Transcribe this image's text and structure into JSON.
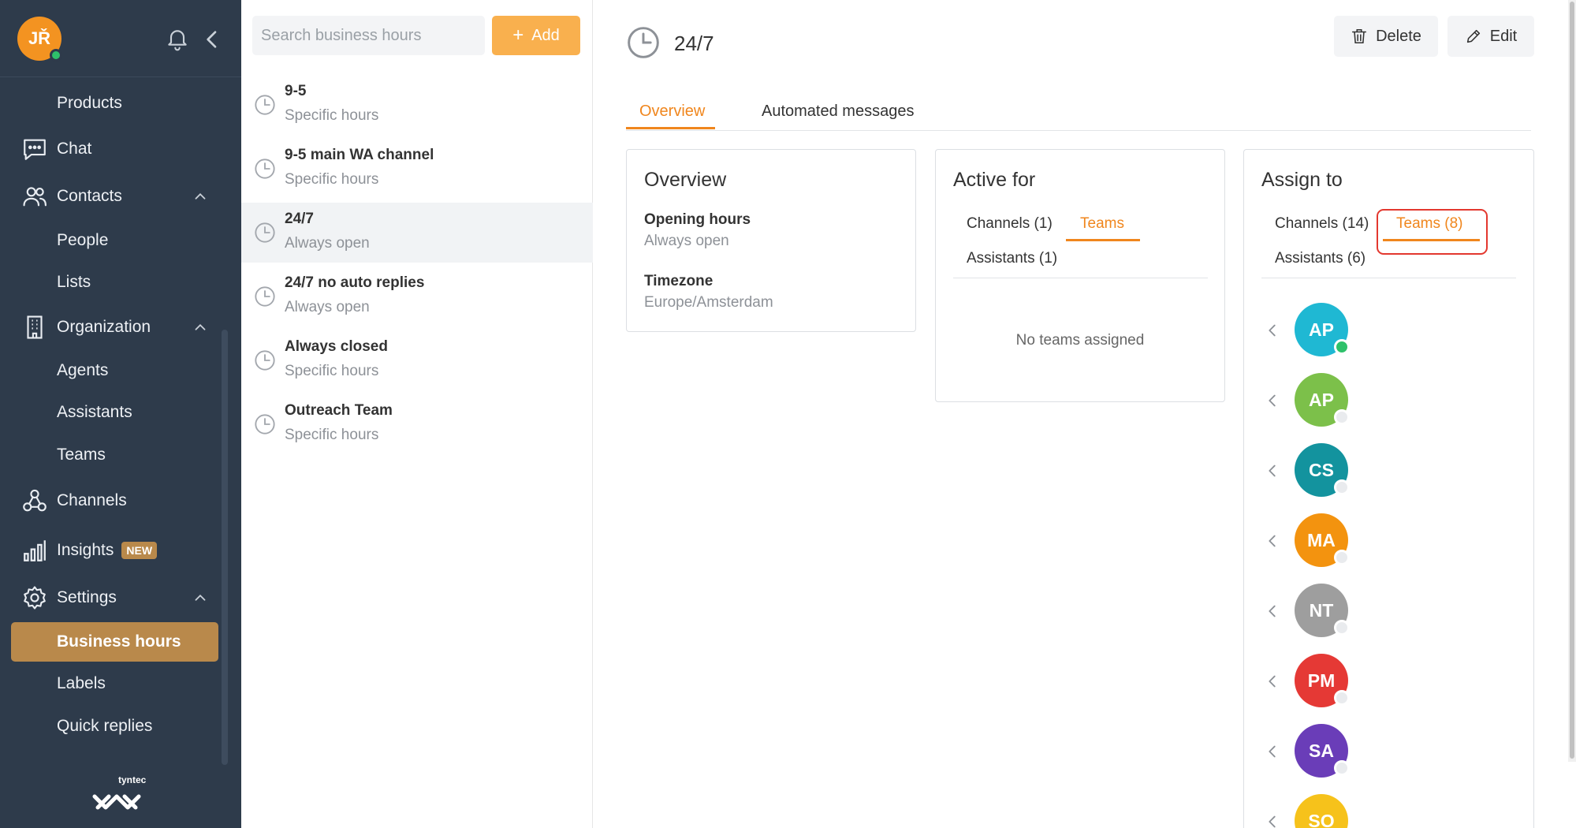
{
  "user": {
    "initials": "JŘ"
  },
  "sidebar": {
    "items": [
      {
        "label": "Products"
      },
      {
        "label": "Chat"
      },
      {
        "label": "Contacts"
      },
      {
        "label": "People"
      },
      {
        "label": "Lists"
      },
      {
        "label": "Organization"
      },
      {
        "label": "Agents"
      },
      {
        "label": "Assistants"
      },
      {
        "label": "Teams"
      },
      {
        "label": "Channels"
      },
      {
        "label": "Insights",
        "badge": "NEW"
      },
      {
        "label": "Settings"
      },
      {
        "label": "Business hours"
      },
      {
        "label": "Labels"
      },
      {
        "label": "Quick replies"
      }
    ],
    "logo_text": "tyntec"
  },
  "list": {
    "search_placeholder": "Search business hours",
    "add_label": "Add",
    "items": [
      {
        "name": "9-5",
        "sub": "Specific hours"
      },
      {
        "name": "9-5 main WA channel",
        "sub": "Specific hours"
      },
      {
        "name": "24/7",
        "sub": "Always open"
      },
      {
        "name": "24/7 no auto replies",
        "sub": "Always open"
      },
      {
        "name": "Always closed",
        "sub": "Specific hours"
      },
      {
        "name": "Outreach Team",
        "sub": "Specific hours"
      }
    ]
  },
  "detail": {
    "title": "24/7",
    "delete_label": "Delete",
    "edit_label": "Edit",
    "tabs": [
      "Overview",
      "Automated messages"
    ],
    "overview": {
      "title": "Overview",
      "opening_hours_label": "Opening hours",
      "opening_hours_value": "Always open",
      "timezone_label": "Timezone",
      "timezone_value": "Europe/Amsterdam"
    },
    "active_for": {
      "title": "Active for",
      "tabs": [
        "Channels (1)",
        "Teams",
        "Assistants (1)"
      ],
      "empty_text": "No teams assigned"
    },
    "assign_to": {
      "title": "Assign to",
      "tabs": [
        "Channels (14)",
        "Teams (8)",
        "Assistants (6)"
      ],
      "teams": [
        {
          "initials": "AP",
          "color": "#1fb8d3",
          "online": true
        },
        {
          "initials": "AP",
          "color": "#7cc04a",
          "online": false
        },
        {
          "initials": "CS",
          "color": "#13939e",
          "online": false
        },
        {
          "initials": "MA",
          "color": "#f3930f",
          "online": false
        },
        {
          "initials": "NT",
          "color": "#9e9e9e",
          "online": false
        },
        {
          "initials": "PM",
          "color": "#e53935",
          "online": false
        },
        {
          "initials": "SA",
          "color": "#6a3db8",
          "online": false
        },
        {
          "initials": "SO",
          "color": "#f6c21b",
          "online": false
        }
      ]
    }
  },
  "colors": {
    "sidebar": "#2e3b4b",
    "accent": "#f0861d",
    "active_nav": "#b9894b",
    "add_button": "#f9b04e",
    "highlight": "#e3382f"
  }
}
